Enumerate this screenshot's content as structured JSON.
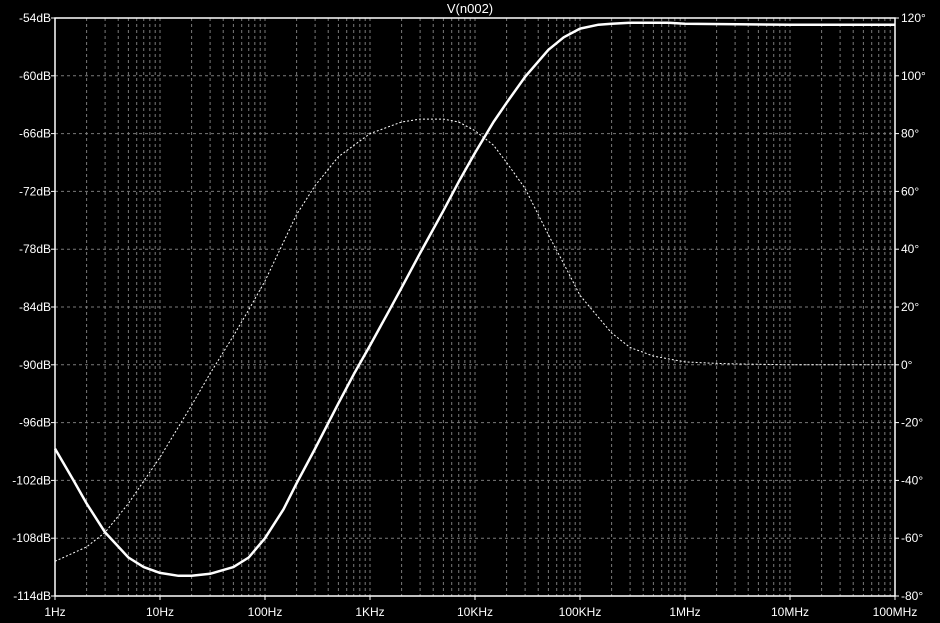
{
  "chart_data": {
    "type": "line",
    "title": "V(n002)",
    "x_scale": "log",
    "xlim_hz": [
      1,
      100000000
    ],
    "x_tick_labels": [
      "1Hz",
      "10Hz",
      "100Hz",
      "1KHz",
      "10KHz",
      "100KHz",
      "1MHz",
      "10MHz",
      "100MHz"
    ],
    "x_tick_values_hz": [
      1,
      10,
      100,
      1000,
      10000,
      100000,
      1000000,
      10000000,
      100000000
    ],
    "left_axis": {
      "unit": "dB",
      "ylim": [
        -114,
        -54
      ],
      "tick_labels": [
        "-54dB",
        "-60dB",
        "-66dB",
        "-72dB",
        "-78dB",
        "-84dB",
        "-90dB",
        "-96dB",
        "-102dB",
        "-108dB",
        "-114dB"
      ],
      "tick_values": [
        -54,
        -60,
        -66,
        -72,
        -78,
        -84,
        -90,
        -96,
        -102,
        -108,
        -114
      ]
    },
    "right_axis": {
      "unit": "degrees",
      "ylim": [
        -80,
        120
      ],
      "tick_labels": [
        "120°",
        "100°",
        "80°",
        "60°",
        "40°",
        "20°",
        "0°",
        "-20°",
        "-40°",
        "-60°",
        "-80°"
      ],
      "tick_values": [
        120,
        100,
        80,
        60,
        40,
        20,
        0,
        -20,
        -40,
        -60,
        -80
      ]
    },
    "grid": true,
    "series": [
      {
        "style": "solid",
        "axis": "left",
        "x": [
          1,
          1.5,
          2,
          3,
          5,
          7,
          10,
          15,
          20,
          30,
          50,
          70,
          100,
          150,
          200,
          300,
          500,
          700,
          1000,
          1500,
          2000,
          3000,
          5000,
          7000,
          10000,
          15000,
          20000,
          30000,
          50000,
          70000,
          100000,
          150000,
          200000,
          300000,
          500000,
          700000,
          1000000,
          10000000,
          100000000
        ],
        "y": [
          -98.7,
          -102.0,
          -104.4,
          -107.4,
          -110.0,
          -111.0,
          -111.6,
          -111.9,
          -111.9,
          -111.7,
          -111.0,
          -110.0,
          -108.0,
          -105.0,
          -102.3,
          -98.7,
          -94.0,
          -91.0,
          -88.0,
          -84.5,
          -82.0,
          -78.4,
          -74.0,
          -71.0,
          -68.0,
          -64.8,
          -62.8,
          -60.1,
          -57.3,
          -56.0,
          -55.1,
          -54.7,
          -54.6,
          -54.5,
          -54.5,
          -54.5,
          -54.6,
          -54.7,
          -54.7
        ]
      },
      {
        "style": "dotted",
        "axis": "right",
        "x": [
          1,
          2,
          3,
          5,
          10,
          20,
          30,
          50,
          70,
          100,
          200,
          300,
          500,
          1000,
          2000,
          3000,
          5000,
          7000,
          10000,
          15000,
          20000,
          30000,
          50000,
          70000,
          100000,
          200000,
          300000,
          500000,
          1000000,
          2000000,
          3000000,
          10000000,
          100000000
        ],
        "y": [
          -68,
          -63,
          -58,
          -48,
          -32,
          -14,
          -3,
          10,
          19,
          29,
          52,
          62,
          72,
          80,
          84,
          85,
          85,
          84,
          81,
          76,
          70,
          61,
          45,
          35,
          24,
          11,
          6,
          3,
          1,
          0.5,
          0.3,
          0,
          0
        ]
      }
    ]
  }
}
